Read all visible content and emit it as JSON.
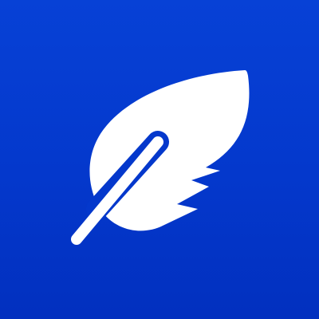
{
  "icon": {
    "name": "feather-icon",
    "background_color": "#0438cc",
    "foreground_color": "#ffffff"
  }
}
